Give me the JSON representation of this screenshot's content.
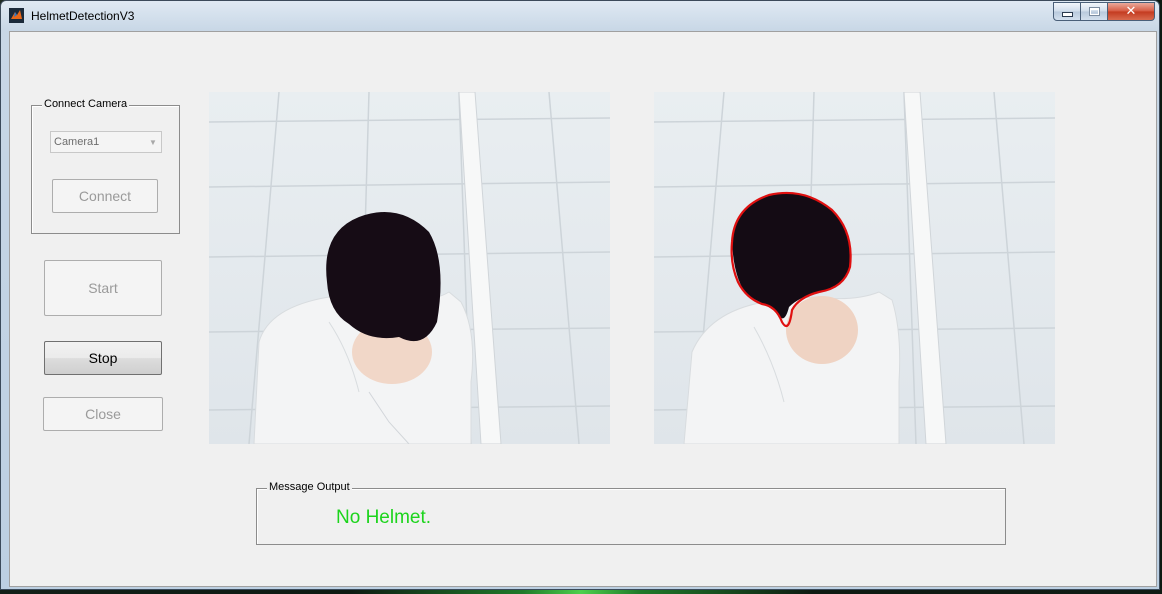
{
  "window": {
    "title": "HelmetDetectionV3"
  },
  "connect_camera": {
    "group_label": "Connect Camera",
    "camera_select": {
      "selected": "Camera1"
    },
    "connect_label": "Connect"
  },
  "controls": {
    "start_label": "Start",
    "stop_label": "Stop",
    "close_label": "Close"
  },
  "message_output": {
    "group_label": "Message Output",
    "message": "No Helmet.",
    "message_color": "#1cd41c"
  },
  "icons": {
    "app": "matlab-icon",
    "minimize": "minimize-icon",
    "maximize": "maximize-icon",
    "close": "close-icon",
    "dropdown": "chevron-down-icon"
  }
}
